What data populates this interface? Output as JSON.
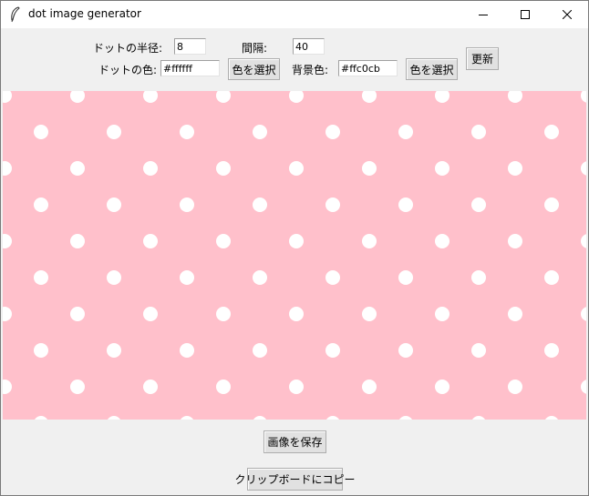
{
  "window": {
    "title": "dot image generator",
    "icons": {
      "app": "feather-icon",
      "minimize": "minimize-icon",
      "maximize": "maximize-icon",
      "close": "close-icon"
    }
  },
  "controls": {
    "radius_label": "ドットの半径:",
    "radius_value": "8",
    "spacing_label": "間隔:",
    "spacing_value": "40",
    "dot_color_label": "ドットの色:",
    "dot_color_value": "#ffffff",
    "bg_color_label": "背景色:",
    "bg_color_value": "#ffc0cb",
    "choose_color_button": "色を選択",
    "choose_bg_color_button": "色を選択",
    "update_button": "更新"
  },
  "canvas": {
    "dot_color": "#ffffff",
    "background_color": "#ffc0cb",
    "dot_radius": 8,
    "dot_spacing": 40
  },
  "actions": {
    "save_button": "画像を保存",
    "copy_button": "クリップボードにコピー"
  },
  "colors": {
    "titlebar": "#ffffff",
    "window_bg": "#f0f0f0",
    "button_bg": "#e1e1e1"
  }
}
